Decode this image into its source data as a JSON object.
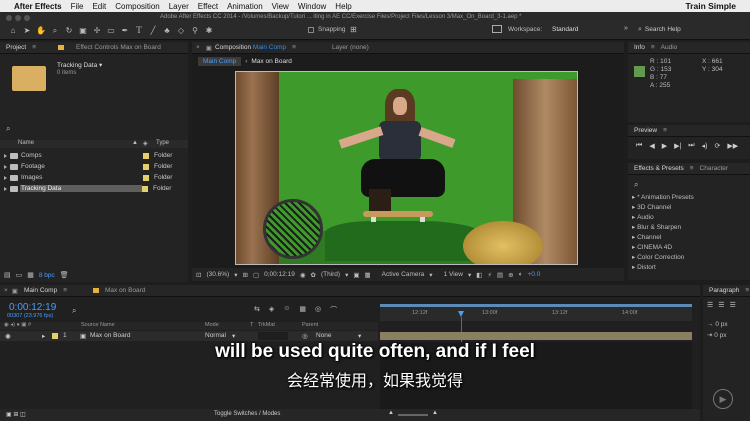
{
  "menubar": {
    "app": "After Effects",
    "items": [
      "File",
      "Edit",
      "Composition",
      "Layer",
      "Effect",
      "Animation",
      "View",
      "Window",
      "Help"
    ],
    "right": "Train Simple"
  },
  "window_title": "Adobe After Effects CC 2014 - /Volumes/Backup/Tutori ... iting in AE CC/Exercise Files/Project Files/Lesson 3/Max_On_Board_3-1.aep *",
  "toolbar": {
    "snapping": "Snapping",
    "workspace_label": "Workspace:",
    "workspace_value": "Standard",
    "search_placeholder": "Search Help"
  },
  "project": {
    "tab": "Project",
    "effect_controls_tab": "Effect Controls Max on Board",
    "selected_name": "Tracking Data ▾",
    "selected_info": "0 items",
    "col_name": "Name",
    "col_type": "Type",
    "items": [
      {
        "name": "Comps",
        "type": "Folder"
      },
      {
        "name": "Footage",
        "type": "Folder"
      },
      {
        "name": "Images",
        "type": "Folder"
      },
      {
        "name": "Tracking Data",
        "type": "Folder"
      }
    ],
    "bpc": "8 bpc"
  },
  "comp_panel": {
    "tab_prefix": "Composition",
    "tab_name": "Main Comp",
    "layer_tab": "Layer (none)",
    "subtabs": [
      "Main Comp",
      "Max on Board"
    ],
    "zoom": "(30.6%)",
    "timecode": "0;00:12:19",
    "resolution": "(Third)",
    "camera": "Active Camera",
    "view": "1 View",
    "exposure": "+0.0"
  },
  "info": {
    "tab": "Info",
    "audio_tab": "Audio",
    "r": "R : 101",
    "g": "G : 153",
    "b": "B : 77",
    "a": "A : 255",
    "x": "X : 661",
    "y": "Y : 304",
    "color": "#659a4d"
  },
  "preview": {
    "tab": "Preview"
  },
  "effects": {
    "tab": "Effects & Presets",
    "character_tab": "Character",
    "items": [
      "* Animation Presets",
      "3D Channel",
      "Audio",
      "Blur & Sharpen",
      "Channel",
      "CINEMA 4D",
      "Color Correction",
      "Distort"
    ]
  },
  "timeline": {
    "tabs": [
      "Main Comp",
      "Max on Board"
    ],
    "timecode": "0:00:12:19",
    "frames": "00307 (23.976 fps)",
    "columns": {
      "source": "Source Name",
      "mode": "Mode",
      "trkmat": "TrkMat",
      "parent": "Parent"
    },
    "layer": {
      "index": "1",
      "name": "Max on Board",
      "mode": "Normal",
      "parent": "None"
    },
    "ruler": [
      "12:12f",
      "13:00f",
      "13:12f",
      "14:00f"
    ],
    "footer": "Toggle Switches / Modes"
  },
  "paragraph": {
    "tab": "Paragraph",
    "fields": [
      "0 px",
      "0 px"
    ]
  },
  "subtitles": {
    "en": "will be used quite often, and if I feel",
    "zh": "会经常使用，如果我觉得"
  }
}
